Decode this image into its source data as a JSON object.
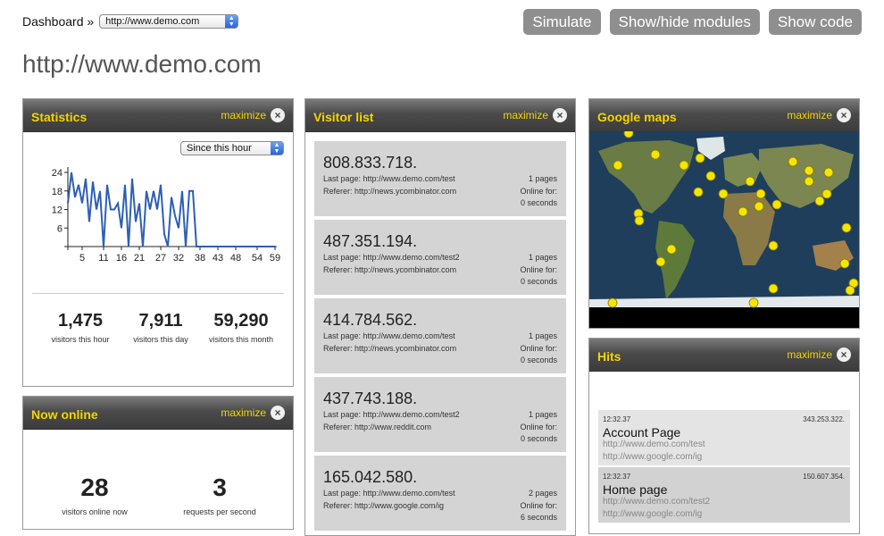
{
  "topbar": {
    "breadcrumb": "Dashboard »",
    "site_select_value": "http://www.demo.com"
  },
  "buttons": {
    "simulate": "Simulate",
    "show_hide": "Show/hide modules",
    "show_code": "Show code"
  },
  "page_title": "http://www.demo.com",
  "statistics": {
    "title": "Statistics",
    "maximize": "maximize",
    "period_select": "Since this hour",
    "stats": [
      {
        "value": "1,475",
        "label": "visitors this hour"
      },
      {
        "value": "7,911",
        "label": "visitors this day"
      },
      {
        "value": "59,290",
        "label": "visitors this month"
      }
    ],
    "chart_data": {
      "type": "line",
      "x_ticks": [
        "5",
        "11",
        "16",
        "21",
        "27",
        "32",
        "38",
        "43",
        "48",
        "54",
        "59"
      ],
      "y_ticks": [
        "24",
        "18",
        "12",
        "6"
      ],
      "ylim": [
        0,
        24
      ],
      "values": [
        14,
        24,
        16,
        20,
        14,
        22,
        8,
        21,
        12,
        18,
        0,
        20,
        12,
        12,
        14,
        6,
        20,
        0,
        22,
        8,
        14,
        0,
        18,
        12,
        18,
        12,
        20,
        4,
        0,
        16,
        10,
        6,
        18,
        0,
        18,
        18,
        0,
        0,
        0,
        0,
        0,
        0,
        0,
        0,
        0,
        0,
        0,
        0,
        0,
        0,
        0,
        0,
        0,
        0,
        0,
        0,
        0,
        0,
        0
      ],
      "color": "#2d5fb5"
    }
  },
  "now_online": {
    "title": "Now online",
    "maximize": "maximize",
    "items": [
      {
        "value": "28",
        "label": "visitors online now"
      },
      {
        "value": "3",
        "label": "requests per second"
      }
    ]
  },
  "visitor_list": {
    "title": "Visitor list",
    "maximize": "maximize",
    "visitors": [
      {
        "ip": "808.833.718.",
        "last_page": "Last page: http://www.demo.com/test",
        "referer": "Referer: http://news.ycombinator.com",
        "pages": "1 pages",
        "online_for": "Online for:",
        "seconds": "0 seconds"
      },
      {
        "ip": "487.351.194.",
        "last_page": "Last page: http://www.demo.com/test2",
        "referer": "Referer: http://news.ycombinator.com",
        "pages": "1 pages",
        "online_for": "Online for:",
        "seconds": "0 seconds"
      },
      {
        "ip": "414.784.562.",
        "last_page": "Last page: http://www.demo.com/test",
        "referer": "Referer: http://news.ycombinator.com",
        "pages": "1 pages",
        "online_for": "Online for:",
        "seconds": "0 seconds"
      },
      {
        "ip": "437.743.188.",
        "last_page": "Last page: http://www.demo.com/test2",
        "referer": "Referer: http://www.reddit.com",
        "pages": "1 pages",
        "online_for": "Online for:",
        "seconds": "0 seconds"
      },
      {
        "ip": "165.042.580.",
        "last_page": "Last page: http://www.demo.com/test",
        "referer": "Referer: http://www.google.com/ig",
        "pages": "2 pages",
        "online_for": "Online for:",
        "seconds": "6 seconds"
      }
    ]
  },
  "google_maps": {
    "title": "Google maps",
    "maximize": "maximize",
    "ocean_color": "#1f3e5c",
    "land_color": "#6a7b45",
    "marker_color": "#f4e600",
    "marker_count": 31
  },
  "hits": {
    "title": "Hits",
    "maximize": "maximize",
    "items": [
      {
        "time": "12:32.37",
        "ip": "343.253.322.",
        "title": "Account Page",
        "url": "http://www.demo.com/test",
        "referer": "http://www.google.com/ig"
      },
      {
        "time": "12:32.37",
        "ip": "150.607.354.",
        "title": "Home page",
        "url": "http://www.demo.com/test2",
        "referer": "http://www.google.com/ig"
      }
    ]
  },
  "icons": {
    "close": "close-icon",
    "dropdown": "dropdown-arrows-icon"
  }
}
